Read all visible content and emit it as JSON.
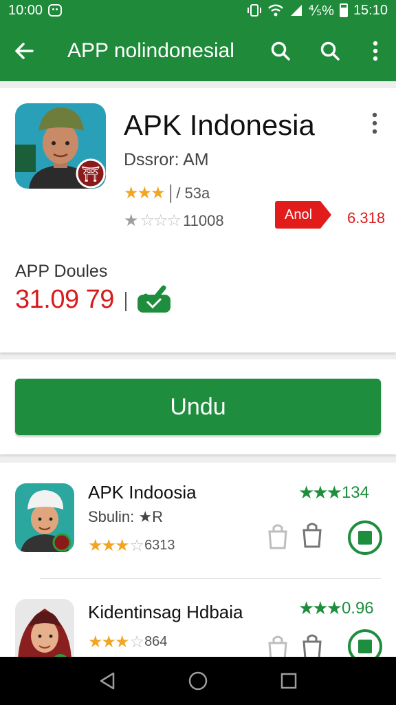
{
  "status_bar": {
    "time_left": "10:00",
    "signal_text": "⅘%",
    "time_right": "15:10"
  },
  "app_bar": {
    "title": "APP nolindonesial",
    "back_icon": "arrow-back-icon",
    "search_icon": "search-icon",
    "menu_icon": "more-vert-icon"
  },
  "app": {
    "name": "APK Indonesia",
    "developer": "Dssror: AM",
    "rating_row1_text": "│/ 53a",
    "rating_row2_text": "11008",
    "badge_label": "Anol",
    "badge_value": "6.318",
    "downloads_label": "APP Doules",
    "downloads_count": "31.09 79"
  },
  "install_button": {
    "label": "Undu"
  },
  "list": [
    {
      "title": "APK Indoosia",
      "subtitle": "Sbulin: ★R",
      "stars_text": "6313",
      "rating": "134"
    },
    {
      "title": "Kidentinsag Hdbaia",
      "subtitle": "",
      "stars_text": "864",
      "rating": "0.96"
    }
  ],
  "colors": {
    "primary": "#1e8a3a",
    "accent_red": "#d81b1b",
    "star": "#f2a522"
  }
}
